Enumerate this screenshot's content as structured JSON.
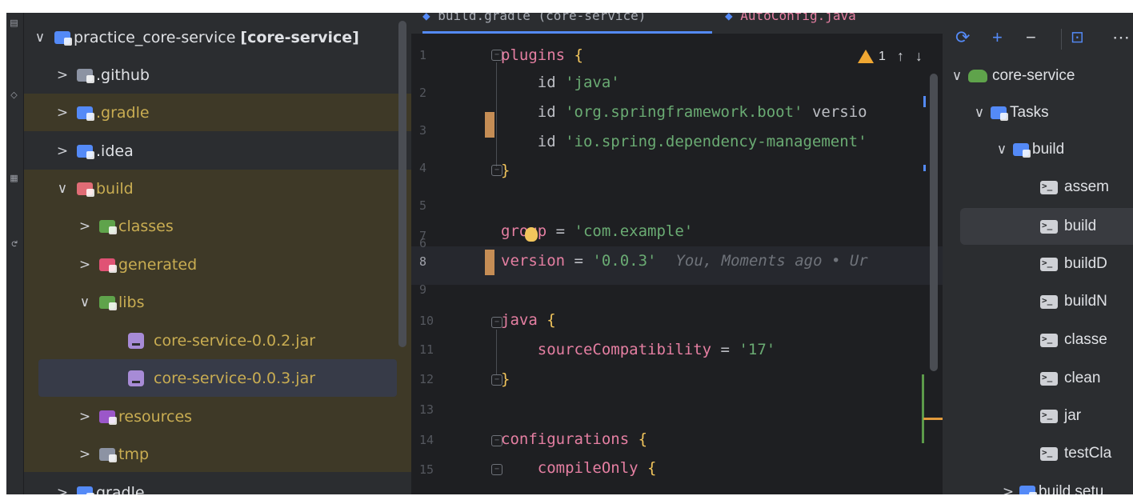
{
  "tabs": [
    {
      "label": "build.gradle (core-service)",
      "active": true
    },
    {
      "label": "AutoConfig.java",
      "active": false
    }
  ],
  "project_tree": {
    "root_label": "practice_core-service",
    "root_module": "[core-service]",
    "items": [
      {
        "label": ".github",
        "chevron": ">",
        "icon": "github-folder-icon",
        "icon_color": "#8c93a3"
      },
      {
        "label": ".gradle",
        "chevron": ">",
        "icon": "gradle-folder-icon",
        "icon_color": "#548af7"
      },
      {
        "label": ".idea",
        "chevron": ">",
        "icon": "idea-folder-icon",
        "icon_color": "#548af7"
      },
      {
        "label": "build",
        "chevron": "∨",
        "icon": "build-folder-icon",
        "icon_color": "#e06c75"
      },
      {
        "label": "classes",
        "chevron": ">",
        "icon": "classes-folder-icon",
        "icon_color": "#5fa34b"
      },
      {
        "label": "generated",
        "chevron": ">",
        "icon": "generated-folder-icon",
        "icon_color": "#e05274"
      },
      {
        "label": "libs",
        "chevron": "∨",
        "icon": "libs-folder-icon",
        "icon_color": "#5fa34b"
      },
      {
        "label": "core-service-0.0.2.jar",
        "chevron": "",
        "icon": "jar-icon"
      },
      {
        "label": "core-service-0.0.3.jar",
        "chevron": "",
        "icon": "jar-icon"
      },
      {
        "label": "resources",
        "chevron": ">",
        "icon": "resources-folder-icon",
        "icon_color": "#9b57c9"
      },
      {
        "label": "tmp",
        "chevron": ">",
        "icon": "tmp-folder-icon",
        "icon_color": "#8c93a3"
      },
      {
        "label": "gradle",
        "chevron": ">",
        "icon": "gradle-folder-icon",
        "icon_color": "#548af7"
      }
    ]
  },
  "editor": {
    "line_numbers": [
      "1",
      "2",
      "3",
      "4",
      "5",
      "6",
      "7",
      "8",
      "9",
      "10",
      "11",
      "12",
      "13",
      "14",
      "15"
    ],
    "problems_count": "1",
    "inline_hint": "You, Moments ago • Ur",
    "code": {
      "l1_kw": "plugins",
      "l1_br": " {",
      "l2_a": "    id ",
      "l2_s": "'java'",
      "l3_a": "    id ",
      "l3_s": "'org.springframework.boot'",
      "l3_b": " versio",
      "l4_a": "    id ",
      "l4_s": "'io.spring.dependency-management'",
      "l5_br": "}",
      "l7_kw": "group",
      "l7_a": " = ",
      "l7_s": "'com.example'",
      "l8_kw": "version",
      "l8_a": " = ",
      "l8_s": "'0.0.3'",
      "l10_kw": "java",
      "l10_br": " {",
      "l11_kw": "    sourceCompatibility",
      "l11_a": " = ",
      "l11_s": "'17'",
      "l12_br": "}",
      "l14_kw": "configurations",
      "l14_br": " {",
      "l15_kw": "    compileOnly",
      "l15_br": " {"
    }
  },
  "gradle_panel": {
    "toolbar": [
      "⟳",
      "+",
      "−",
      "⊡",
      "⋯"
    ],
    "root": "core-service",
    "tasks_label": "Tasks",
    "build_group": "build",
    "tasks": [
      "assem",
      "build",
      "buildD",
      "buildN",
      "classe",
      "clean",
      "jar",
      "testCla"
    ],
    "next_group": "build setu"
  },
  "colors": {
    "accent": "#548af7",
    "ignored_text": "#c9ad52",
    "change_marker": "#c58d55",
    "warning": "#f0a732"
  }
}
